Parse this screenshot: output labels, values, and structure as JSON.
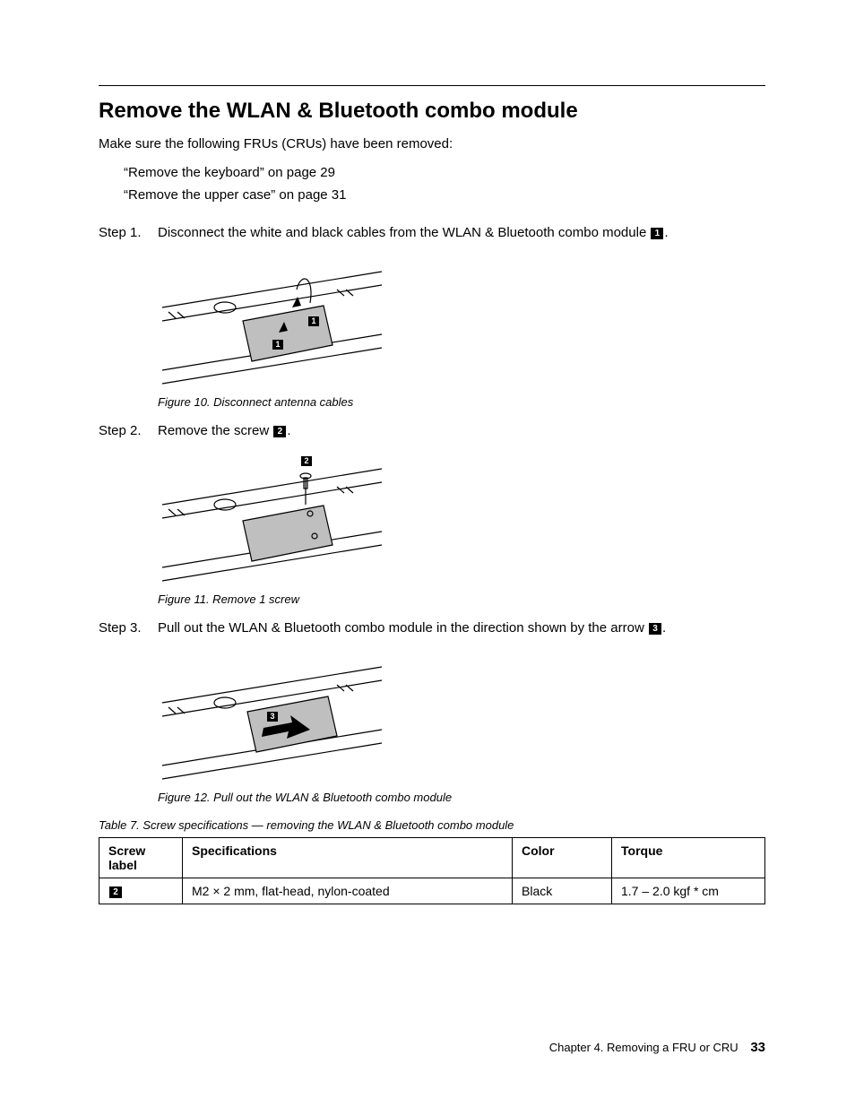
{
  "heading": "Remove the WLAN & Bluetooth combo module",
  "intro": "Make sure the following FRUs (CRUs) have been removed:",
  "prereqs": [
    "“Remove the keyboard” on page 29",
    "“Remove the upper case” on page 31"
  ],
  "steps": [
    {
      "label": "Step 1.",
      "text_before": "Disconnect the white and black cables from the WLAN & Bluetooth combo module ",
      "callout": "1",
      "text_after": ".",
      "figure": {
        "caption": "Figure 10.  Disconnect antenna cables",
        "badges": [
          "1",
          "1"
        ]
      }
    },
    {
      "label": "Step 2.",
      "text_before": "Remove the screw ",
      "callout": "2",
      "text_after": ".",
      "figure": {
        "caption": "Figure 11.  Remove 1 screw",
        "badges": [
          "2"
        ]
      }
    },
    {
      "label": "Step 3.",
      "text_before": "Pull out the WLAN & Bluetooth combo module in the direction shown by the arrow ",
      "callout": "3",
      "text_after": ".",
      "figure": {
        "caption": "Figure 12.  Pull out the WLAN & Bluetooth combo module",
        "badges": [
          "3"
        ]
      }
    }
  ],
  "table": {
    "caption": "Table 7.  Screw specifications — removing the WLAN & Bluetooth combo module",
    "headers": {
      "screw": "Screw label",
      "spec": "Specifications",
      "color": "Color",
      "torque": "Torque"
    },
    "rows": [
      {
        "screw_badge": "2",
        "spec": "M2 × 2 mm, flat-head, nylon-coated",
        "color": "Black",
        "torque": "1.7 – 2.0 kgf * cm"
      }
    ]
  },
  "footer": {
    "chapter": "Chapter 4.  Removing a FRU or CRU",
    "page": "33"
  }
}
